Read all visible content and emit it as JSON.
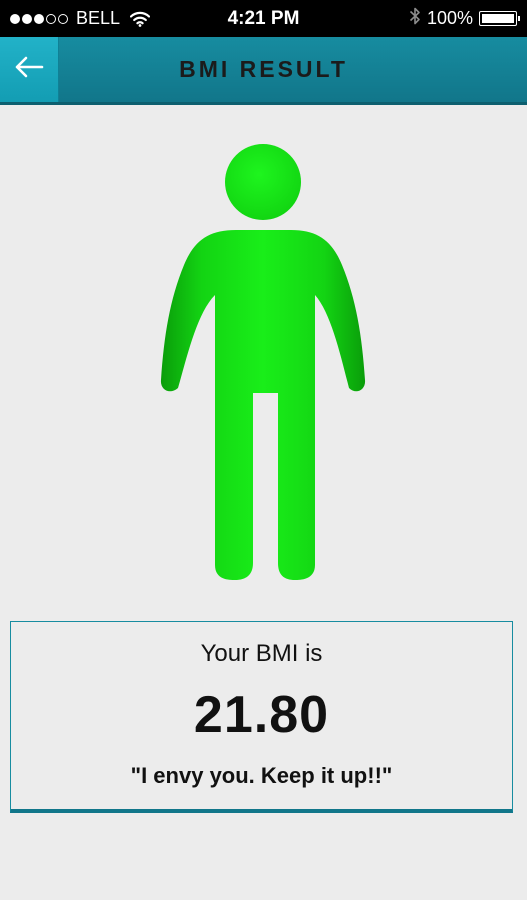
{
  "status_bar": {
    "carrier": "BELL",
    "time": "4:21 PM",
    "battery": "100%",
    "battery_level": 1.0,
    "signal_strength": 3,
    "signal_max": 5,
    "icons": [
      "signal-dots-icon",
      "wifi-icon",
      "bluetooth-icon",
      "battery-icon"
    ]
  },
  "app_bar": {
    "title": "BMI RESULT",
    "back_icon": "arrow-left-icon"
  },
  "figure": {
    "icon": "person-icon",
    "color": "#17e617"
  },
  "result": {
    "label": "Your BMI is",
    "value": "21.80",
    "message": "\"I envy you. Keep it up!!\""
  },
  "colors": {
    "accent": "#178ca0",
    "background": "#ececec",
    "figure_green": "#17e617"
  }
}
